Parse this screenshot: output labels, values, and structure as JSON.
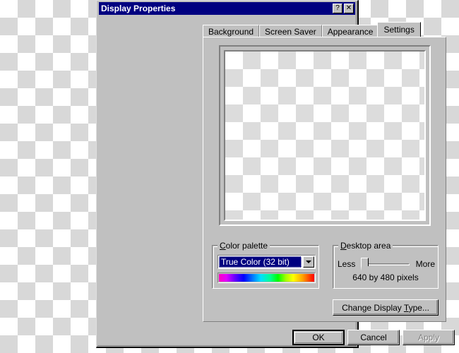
{
  "window": {
    "title": "Display Properties",
    "help_button": "?",
    "close_button": "✕"
  },
  "tabs": [
    {
      "label": "Background",
      "active": false
    },
    {
      "label": "Screen Saver",
      "active": false
    },
    {
      "label": "Appearance",
      "active": false
    },
    {
      "label": "Settings",
      "active": true
    }
  ],
  "preview": {
    "name": "monitor-preview",
    "content": "transparent-checkerboard"
  },
  "color_palette": {
    "group_label_prefix": "C",
    "group_label_rest": "olor palette",
    "selected_value": "True Color (32 bit)",
    "dropdown_arrow": "chevron-down-icon",
    "swatch": "color-gradient-bar"
  },
  "desktop_area": {
    "group_label_prefix": "D",
    "group_label_rest": "esktop area",
    "slider_min_label": "Less",
    "slider_max_label": "More",
    "resolution_text": "640 by 480 pixels",
    "slider_position_percent": 0
  },
  "buttons": {
    "change_display_type_pre": "Change Display ",
    "change_display_type_key": "T",
    "change_display_type_post": "ype...",
    "ok": "OK",
    "cancel": "Cancel",
    "apply": "Apply"
  },
  "colors": {
    "titlebar": "#000080",
    "face": "#c0c0c0",
    "highlight": "#ffffff",
    "shadow": "#808080",
    "dark": "#000000",
    "selection": "#000080",
    "disabled_text": "#808080"
  }
}
